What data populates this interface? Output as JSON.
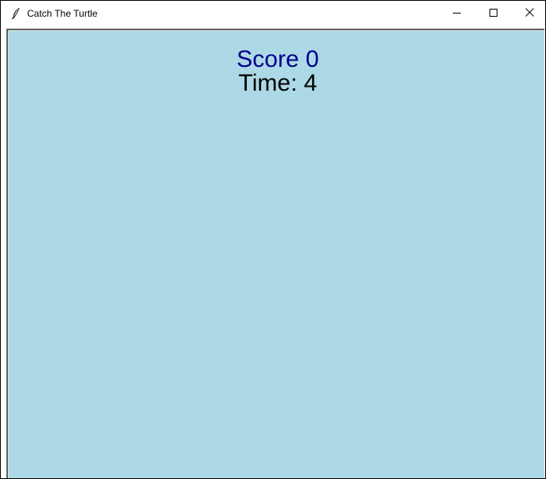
{
  "window": {
    "title": "Catch The Turtle",
    "app_icon": "feather-icon",
    "controls": {
      "minimize_icon": "minimize-icon",
      "maximize_icon": "maximize-icon",
      "close_icon": "close-icon"
    }
  },
  "game": {
    "background_color": "#add8e6",
    "score_text": "Score 0",
    "score_color": "#00008b",
    "time_text": "Time: 4",
    "time_color": "#000000"
  }
}
